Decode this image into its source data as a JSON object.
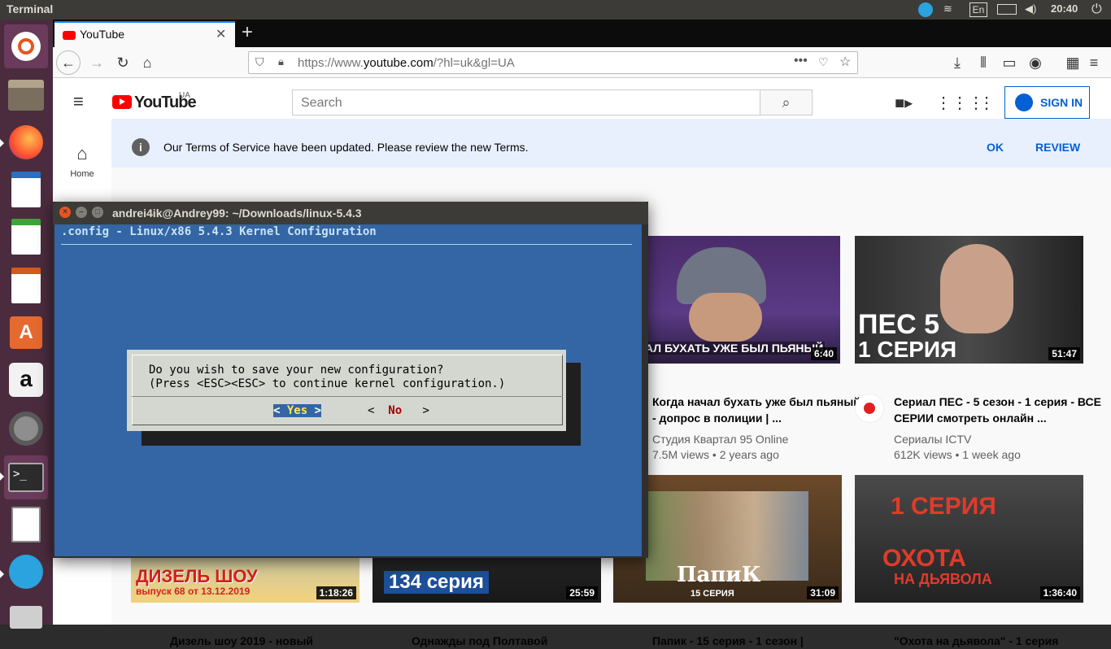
{
  "topbar": {
    "app_title": "Terminal",
    "keyboard": "En",
    "clock": "20:40"
  },
  "launcher": {
    "items": [
      "ubuntu-dash",
      "files",
      "firefox",
      "libreoffice-writer",
      "libreoffice-calc",
      "libreoffice-impress",
      "software-center",
      "amazon",
      "system-settings",
      "terminal",
      "text-editor",
      "telegram"
    ]
  },
  "browser": {
    "tab_title": "YouTube",
    "url_prefix": "https://www.",
    "url_domain": "youtube.com",
    "url_suffix": "/?hl=uk&gl=UA"
  },
  "youtube": {
    "logo_text": "YouTube",
    "country": "UA",
    "search_placeholder": "Search",
    "signin": "SIGN IN",
    "home_label": "Home",
    "tos_text": "Our Terms of Service have been updated. Please review the new Terms.",
    "tos_ok": "OK",
    "tos_review": "REVIEW",
    "videos": [
      {
        "caption": "А НАЧАЛ БУХАТЬ УЖЕ БЫЛ ПЬЯНЫЙ",
        "duration": "6:40",
        "title": "Когда начал бухать уже был пьяный - допрос в полиции | ...",
        "channel": "Студия Квартал 95 Online",
        "meta": "7.5M views • 2 years ago"
      },
      {
        "caption": "ПЕС 5",
        "caption2": "1 СЕРИЯ",
        "duration": "51:47",
        "title": "Сериал ПЕС - 5 сезон - 1 серия - ВСЕ СЕРИИ смотреть онлайн ...",
        "channel": "Сериалы ICTV",
        "meta": "612K views • 1 week ago"
      },
      {
        "caption": "ДИЗЕЛЬ ШОУ",
        "caption2": "выпуск 68 от 13.12.2019",
        "duration": "1:18:26",
        "title": "Дизель шоу 2019 - новый"
      },
      {
        "caption": "134 серия",
        "duration": "25:59",
        "title": "Однажды под Полтавой"
      },
      {
        "caption": "ПапиК",
        "caption2": "15 СЕРИЯ",
        "duration": "31:09",
        "title": "Папик - 15 серия - 1 сезон |"
      },
      {
        "caption": "1 СЕРИЯ",
        "caption2": "ОХОТА",
        "caption3": "НА ДЬЯВОЛА",
        "duration": "1:36:40",
        "title": "\"Охота на дьявола\" - 1 серия"
      }
    ]
  },
  "terminal": {
    "title": "andrei4ik@Andrey99: ~/Downloads/linux-5.4.3",
    "header": ".config - Linux/x86 5.4.3 Kernel Configuration",
    "dialog_line1": "Do you wish to save your new configuration?",
    "dialog_line2": "(Press <ESC><ESC> to continue kernel configuration.)",
    "yes_left": "< ",
    "yes_label": "Yes",
    "yes_right": " >",
    "no_left": "<  ",
    "no_label": "No",
    "no_right": "   >"
  },
  "colors": {
    "terminal_bg": "#3465a4",
    "dialog_bg": "#d3d7cf",
    "launcher_bg": "#4b2c3e",
    "yt_red": "#ff0000",
    "yt_blue": "#065fd4"
  }
}
